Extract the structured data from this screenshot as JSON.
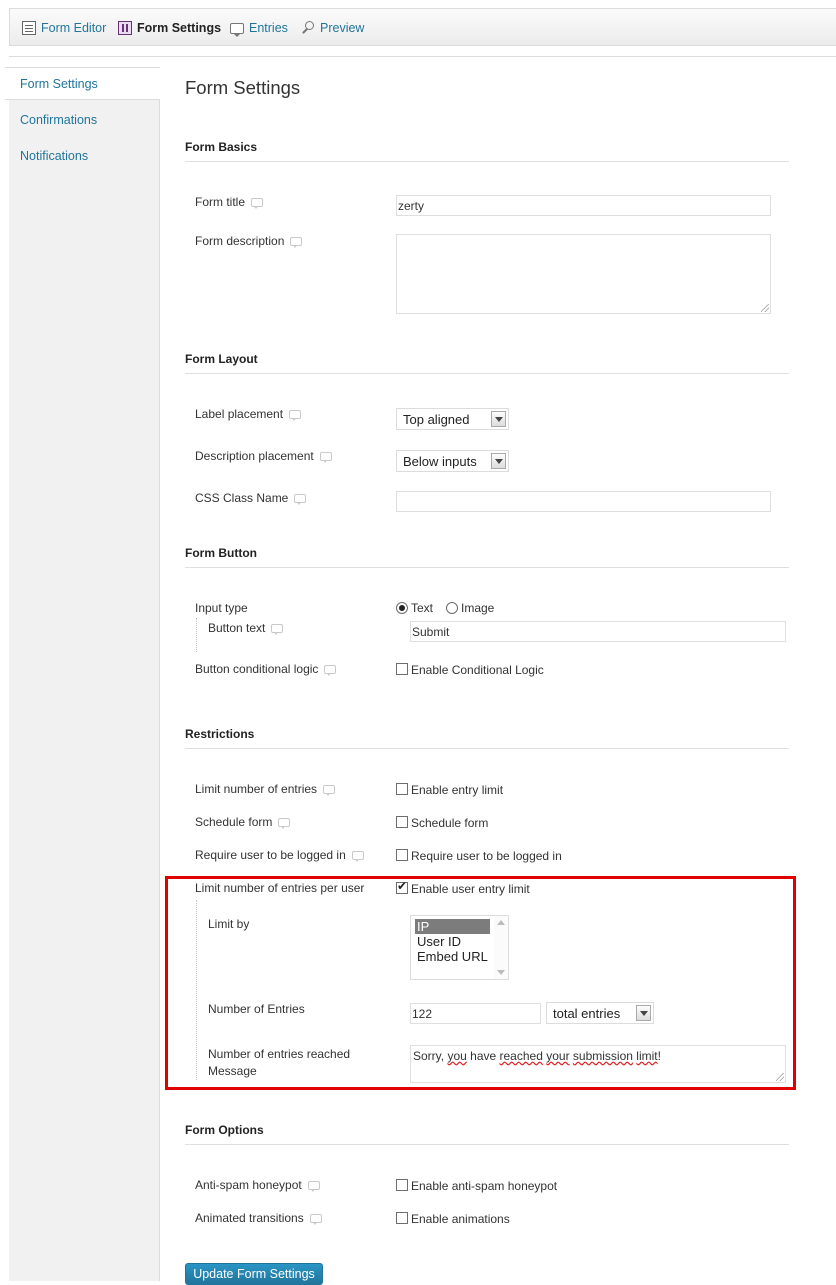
{
  "toolbar": {
    "items": [
      {
        "label": "Form Editor",
        "icon": "form-editor-icon"
      },
      {
        "label": "Form Settings",
        "icon": "form-settings-icon"
      },
      {
        "label": "Entries",
        "icon": "entries-icon"
      },
      {
        "label": "Preview",
        "icon": "preview-icon"
      }
    ]
  },
  "sidebar": {
    "items": [
      {
        "label": "Form Settings"
      },
      {
        "label": "Confirmations"
      },
      {
        "label": "Notifications"
      }
    ]
  },
  "main": {
    "title": "Form Settings",
    "basics": {
      "heading": "Form Basics",
      "title_label": "Form title",
      "title_value": "zerty",
      "description_label": "Form description",
      "description_value": ""
    },
    "layout": {
      "heading": "Form Layout",
      "label_placement_label": "Label placement",
      "label_placement_value": "Top aligned",
      "description_placement_label": "Description placement",
      "description_placement_value": "Below inputs",
      "css_class_label": "CSS Class Name",
      "css_class_value": ""
    },
    "button": {
      "heading": "Form Button",
      "input_type_label": "Input type",
      "option_text": "Text",
      "option_image": "Image",
      "button_text_label": "Button text",
      "button_text_value": "Submit",
      "conditional_label": "Button conditional logic",
      "conditional_checkbox": "Enable Conditional Logic"
    },
    "restrictions": {
      "heading": "Restrictions",
      "limit_entries_label": "Limit number of entries",
      "limit_entries_checkbox": "Enable entry limit",
      "schedule_label": "Schedule form",
      "schedule_checkbox": "Schedule form",
      "require_login_label": "Require user to be logged in",
      "require_login_checkbox": "Require user to be logged in",
      "per_user_label": "Limit number of entries per user",
      "per_user_checkbox": "Enable user entry limit",
      "limit_by_label": "Limit by",
      "limit_by_options": [
        "IP",
        "User ID",
        "Embed URL"
      ],
      "number_entries_label": "Number of Entries",
      "number_entries_value": "122",
      "number_entries_period": "total entries",
      "reached_label_line1": "Number of entries reached",
      "reached_label_line2": "Message",
      "reached_message_parts": [
        "Sorry, ",
        "you",
        " have ",
        "reached",
        " ",
        "your",
        " ",
        "submission",
        " ",
        "limit",
        "!"
      ]
    },
    "options": {
      "heading": "Form Options",
      "honeypot_label": "Anti-spam honeypot",
      "honeypot_checkbox": "Enable anti-spam honeypot",
      "animations_label": "Animated transitions",
      "animations_checkbox": "Enable animations"
    },
    "update_button": "Update Form Settings"
  },
  "colors": {
    "link": "#21759b",
    "highlight_border": "#e00000",
    "primary_button": "#21759b"
  }
}
